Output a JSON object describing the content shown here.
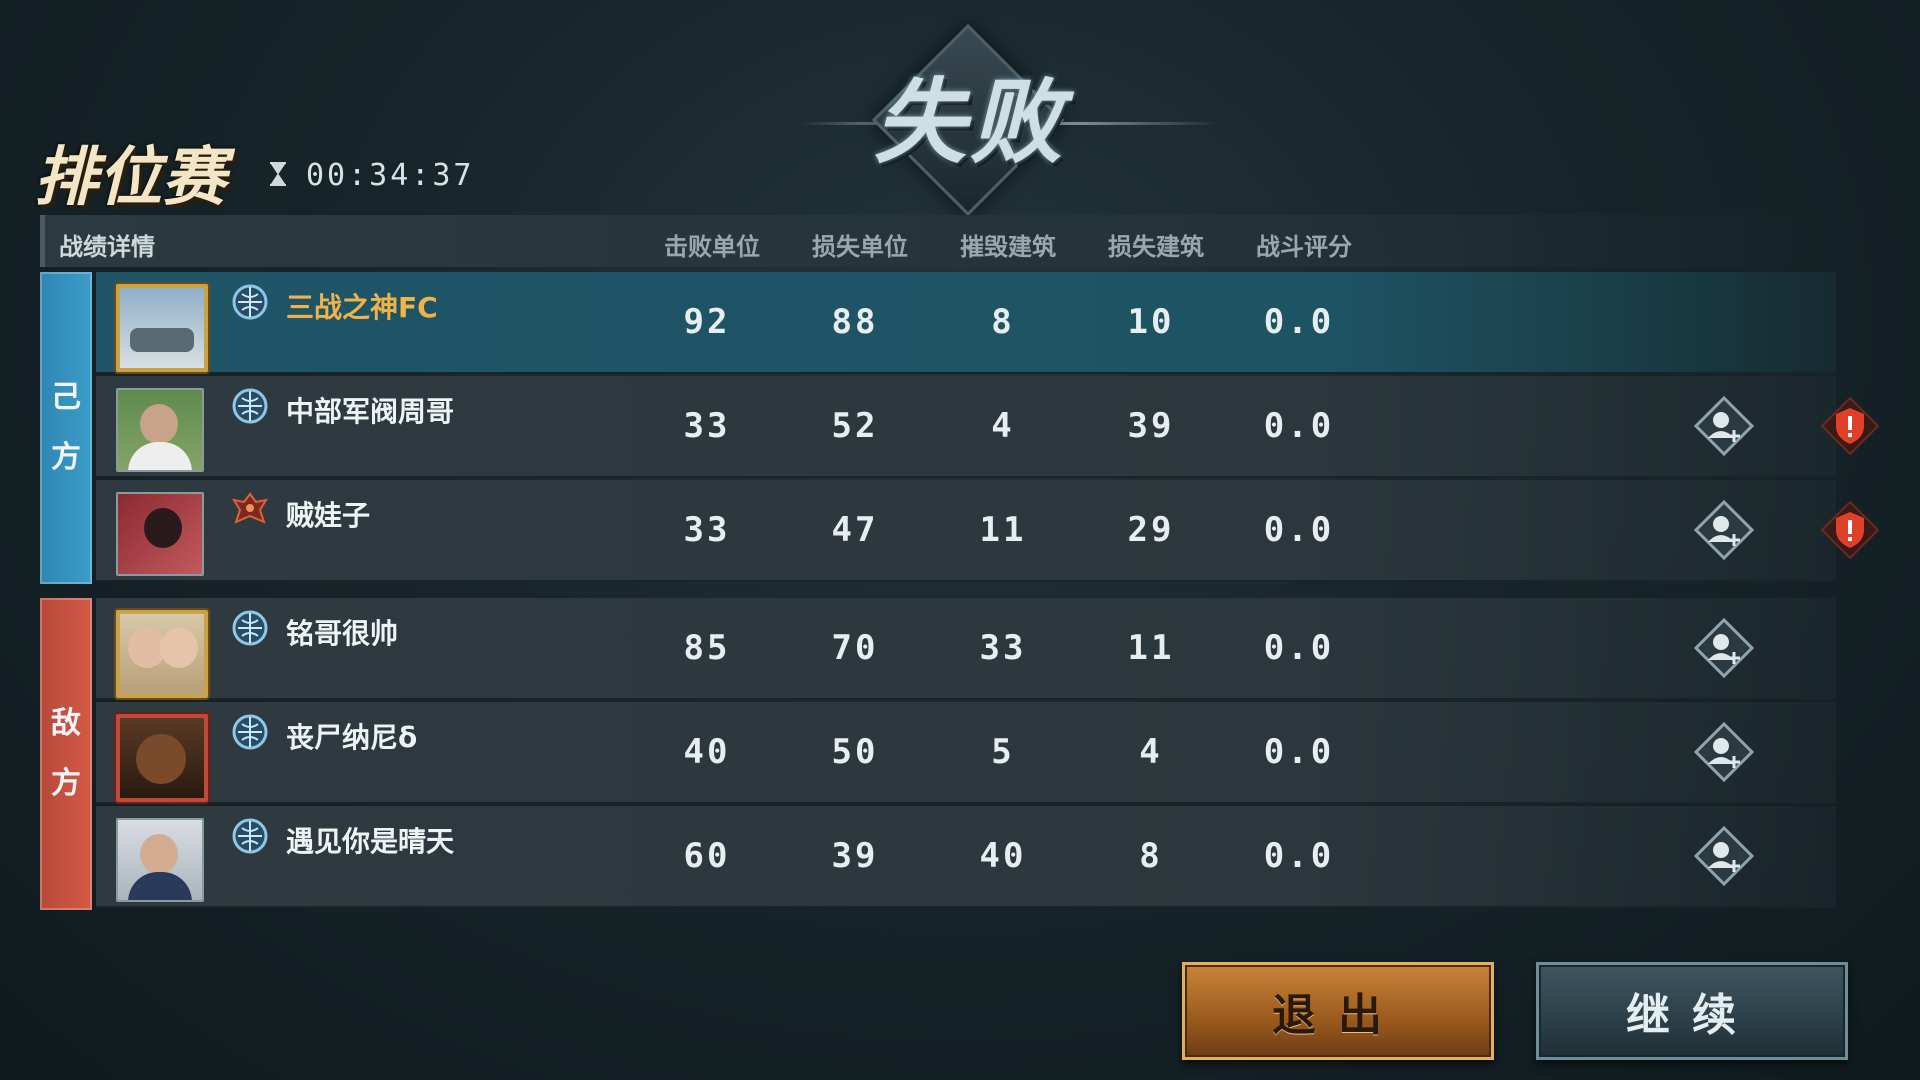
{
  "result": {
    "title": "失败"
  },
  "mode": {
    "title": "排位赛",
    "timer": "00:34:37"
  },
  "table": {
    "section_label": "战绩详情",
    "columns": [
      "击败单位",
      "损失单位",
      "摧毁建筑",
      "损失建筑",
      "战斗评分"
    ]
  },
  "teams": {
    "ally": {
      "label_1": "己",
      "label_2": "方"
    },
    "enemy": {
      "label_1": "敌",
      "label_2": "方"
    }
  },
  "players": [
    {
      "name": "三战之神FC",
      "team": "ally",
      "self": true,
      "rank_icon": "globe-rank-icon",
      "stats": [
        "92",
        "88",
        "8",
        "10",
        "0.0"
      ]
    },
    {
      "name": "中部军阀周哥",
      "team": "ally",
      "self": false,
      "rank_icon": "globe-rank-icon",
      "stats": [
        "33",
        "52",
        "4",
        "39",
        "0.0"
      ]
    },
    {
      "name": "贼娃子",
      "team": "ally",
      "self": false,
      "rank_icon": "eagle-rank-icon",
      "stats": [
        "33",
        "47",
        "11",
        "29",
        "0.0"
      ]
    },
    {
      "name": "铭哥很帅",
      "team": "enemy",
      "self": false,
      "rank_icon": "globe-rank-icon",
      "stats": [
        "85",
        "70",
        "33",
        "11",
        "0.0"
      ]
    },
    {
      "name": "丧尸纳尼δ",
      "team": "enemy",
      "self": false,
      "rank_icon": "globe-rank-icon",
      "stats": [
        "40",
        "50",
        "5",
        "4",
        "0.0"
      ]
    },
    {
      "name": "遇见你是晴天",
      "team": "enemy",
      "self": false,
      "rank_icon": "globe-rank-icon",
      "stats": [
        "60",
        "39",
        "40",
        "8",
        "0.0"
      ]
    }
  ],
  "buttons": {
    "exit": "退出",
    "continue": "继续"
  },
  "colors": {
    "ally": "#3b9dc9",
    "enemy": "#d35a46",
    "self_name": "#f0b24a",
    "report": "#e0402a"
  }
}
